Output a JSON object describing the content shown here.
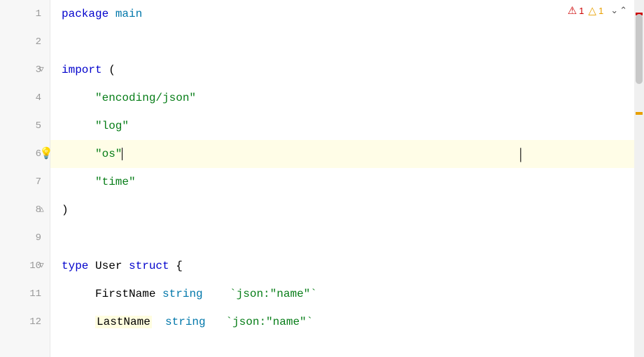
{
  "editor": {
    "lines": [
      {
        "num": 1,
        "tokens": [
          {
            "text": "package ",
            "cls": "kw"
          },
          {
            "text": "main",
            "cls": "pkg"
          }
        ],
        "highlight": false,
        "gutter_icon": null
      },
      {
        "num": 2,
        "tokens": [],
        "highlight": false,
        "gutter_icon": null
      },
      {
        "num": 3,
        "tokens": [
          {
            "text": "import",
            "cls": "kw"
          },
          {
            "text": " (",
            "cls": "punct"
          }
        ],
        "highlight": false,
        "gutter_icon": "fold"
      },
      {
        "num": 4,
        "tokens": [
          {
            "text": "    ",
            "cls": ""
          },
          {
            "text": "\"encoding/json\"",
            "cls": "str"
          }
        ],
        "highlight": false,
        "gutter_icon": null
      },
      {
        "num": 5,
        "tokens": [
          {
            "text": "    ",
            "cls": ""
          },
          {
            "text": "\"log\"",
            "cls": "str"
          }
        ],
        "highlight": false,
        "gutter_icon": null
      },
      {
        "num": 6,
        "tokens": [
          {
            "text": "    ",
            "cls": ""
          },
          {
            "text": "\"os\"",
            "cls": "str"
          },
          {
            "text": "",
            "cls": "cursor"
          }
        ],
        "highlight": true,
        "gutter_icon": "bulb"
      },
      {
        "num": 7,
        "tokens": [
          {
            "text": "    ",
            "cls": ""
          },
          {
            "text": "\"time\"",
            "cls": "str"
          }
        ],
        "highlight": false,
        "gutter_icon": null
      },
      {
        "num": 8,
        "tokens": [
          {
            "text": ")",
            "cls": "punct"
          }
        ],
        "highlight": false,
        "gutter_icon": "fold-end"
      },
      {
        "num": 9,
        "tokens": [],
        "highlight": false,
        "gutter_icon": null
      },
      {
        "num": 10,
        "tokens": [
          {
            "text": "type",
            "cls": "kw"
          },
          {
            "text": " User ",
            "cls": "type-name"
          },
          {
            "text": "struct",
            "cls": "kw"
          },
          {
            "text": " {",
            "cls": "punct"
          }
        ],
        "highlight": false,
        "gutter_icon": "fold"
      },
      {
        "num": 11,
        "tokens": [
          {
            "text": "    FirstName ",
            "cls": "field"
          },
          {
            "text": "string",
            "cls": "builtin"
          },
          {
            "text": "    ",
            "cls": ""
          },
          {
            "text": "`json:\"name\"`",
            "cls": "str"
          }
        ],
        "highlight": false,
        "gutter_icon": null
      },
      {
        "num": 12,
        "tokens": [
          {
            "text": "    ",
            "cls": ""
          },
          {
            "text": "LastName",
            "cls": "highlight"
          },
          {
            "text": "  ",
            "cls": ""
          },
          {
            "text": "string",
            "cls": "builtin"
          },
          {
            "text": "   ",
            "cls": ""
          },
          {
            "text": "`json:\"name\"`",
            "cls": "str"
          }
        ],
        "highlight": false,
        "gutter_icon": null
      }
    ],
    "toolbar": {
      "error_count": "1",
      "warning_count": "1",
      "error_icon": "●",
      "warning_icon": "▲"
    }
  }
}
